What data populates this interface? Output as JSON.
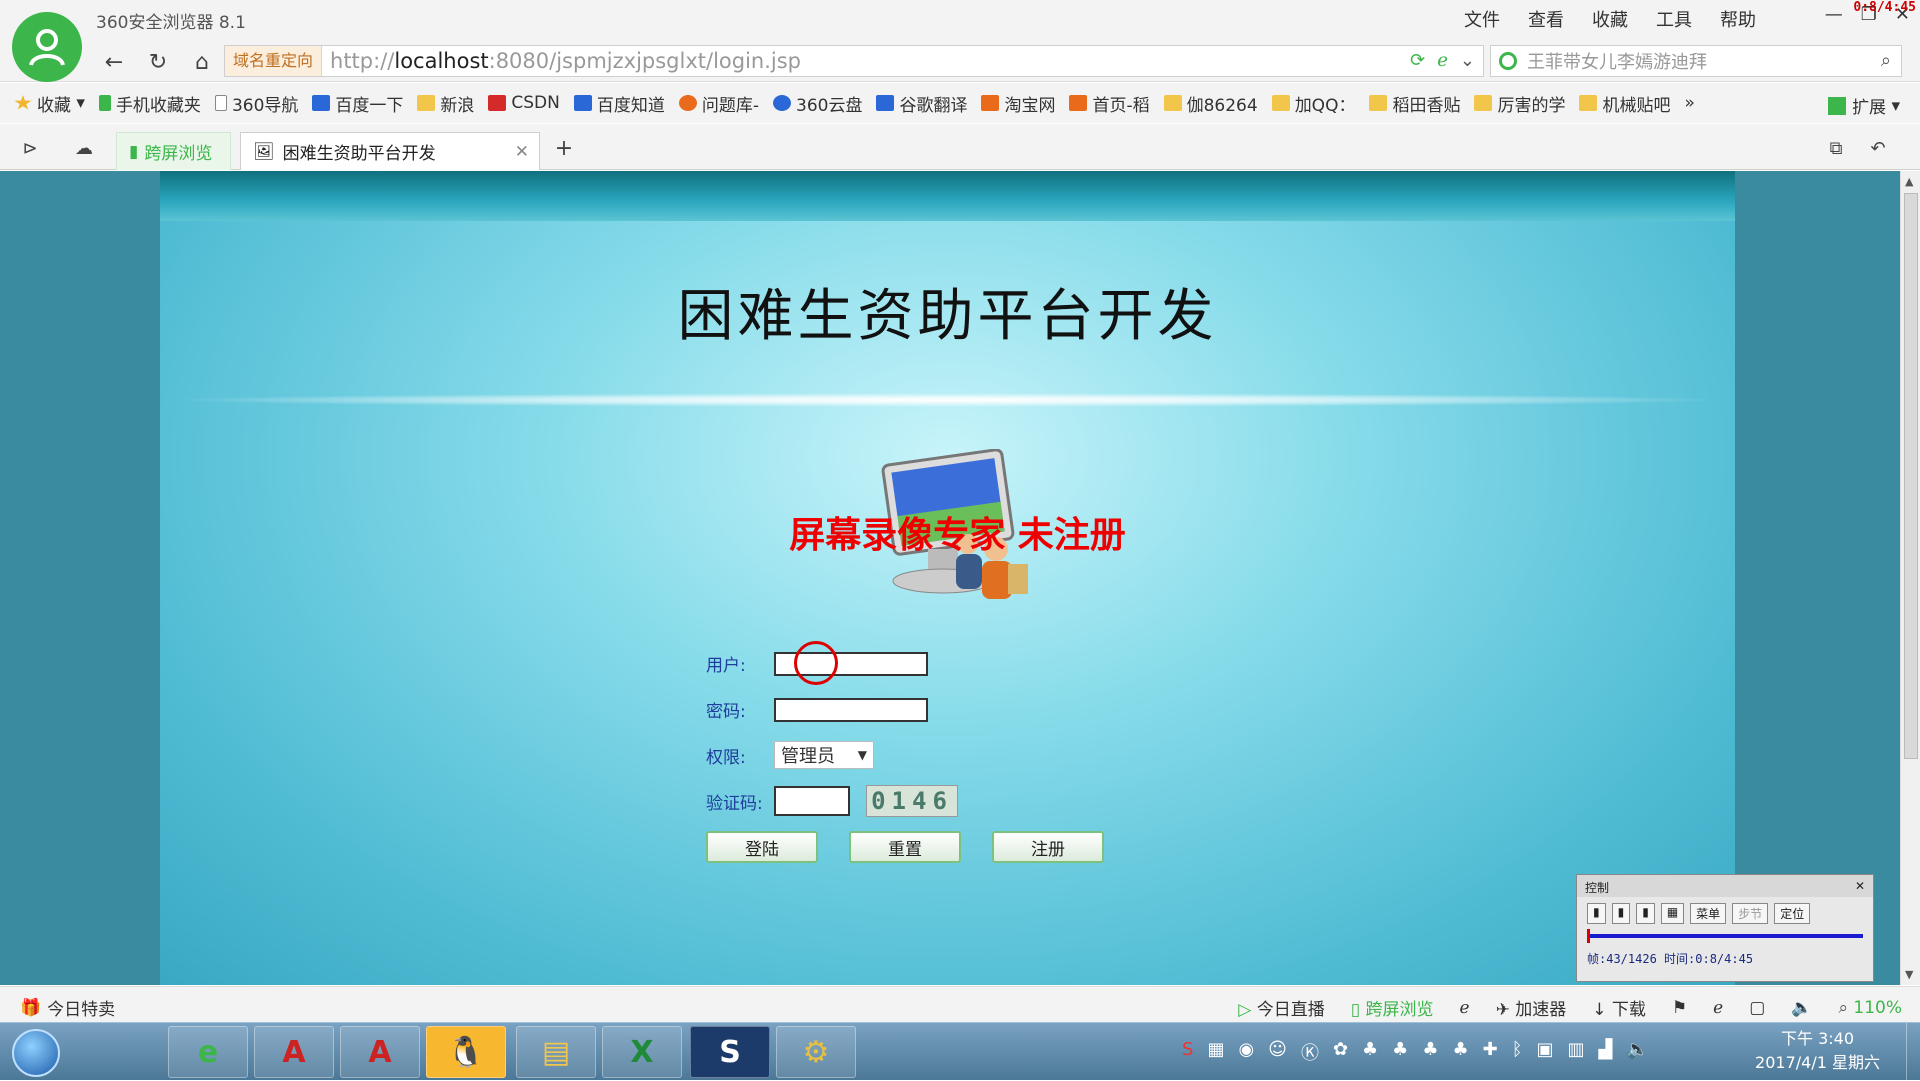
{
  "browser": {
    "title": "360安全浏览器 8.1",
    "menu": [
      "文件",
      "查看",
      "收藏",
      "工具",
      "帮助"
    ],
    "rec_time": "0:8/4:45"
  },
  "nav": {
    "redirect_label": "域名重定向",
    "url_prefix": "http://",
    "url_host": "localhost",
    "url_rest": ":8080/jspmjzxjpsglxt/login.jsp",
    "search_placeholder": "王菲带女儿李嫣游迪拜"
  },
  "bookmarks": [
    {
      "label": "收藏",
      "icon": "star-icon"
    },
    {
      "label": "手机收藏夹",
      "icon": "phone-icon"
    },
    {
      "label": "360导航",
      "icon": "page-icon"
    },
    {
      "label": "百度一下",
      "icon": "baidu-icon"
    },
    {
      "label": "新浪",
      "icon": "folder-icon"
    },
    {
      "label": "CSDN",
      "icon": "csdn-icon"
    },
    {
      "label": "百度知道",
      "icon": "baidu-icon"
    },
    {
      "label": "问题库-",
      "icon": "s-icon"
    },
    {
      "label": "360云盘",
      "icon": "cloud-icon"
    },
    {
      "label": "谷歌翻译",
      "icon": "translate-icon"
    },
    {
      "label": "淘宝网",
      "icon": "taobao-icon"
    },
    {
      "label": "首页-稻",
      "icon": "taobao-icon"
    },
    {
      "label": "伽86264",
      "icon": "folder-icon"
    },
    {
      "label": "加QQ：",
      "icon": "folder-icon"
    },
    {
      "label": "稻田香贴",
      "icon": "folder-icon"
    },
    {
      "label": "厉害的学",
      "icon": "folder-icon"
    },
    {
      "label": "机械贴吧",
      "icon": "folder-icon"
    }
  ],
  "bookmarks_ext": "扩展",
  "tabs": {
    "split_label": "跨屏浏览",
    "active_label": "困难生资助平台开发"
  },
  "page": {
    "title": "困难生资助平台开发",
    "watermark": "屏幕录像专家 未注册",
    "form": {
      "user_label": "用户:",
      "password_label": "密码:",
      "role_label": "权限:",
      "role_value": "管理员",
      "captcha_label": "验证码:",
      "captcha_code": "0146",
      "login_btn": "登陆",
      "reset_btn": "重置",
      "register_btn": "注册"
    }
  },
  "recorder": {
    "title": "控制",
    "btns": [
      "菜单",
      "步节",
      "定位"
    ],
    "info": "帧:43/1426 时间:0:8/4:45"
  },
  "status": {
    "left": "今日特卖",
    "items": [
      "今日直播",
      "跨屏浏览",
      "加速器",
      "下载"
    ],
    "zoom": "110%"
  },
  "clock": {
    "time": "下午 3:40",
    "date": "2017/4/1 星期六"
  }
}
